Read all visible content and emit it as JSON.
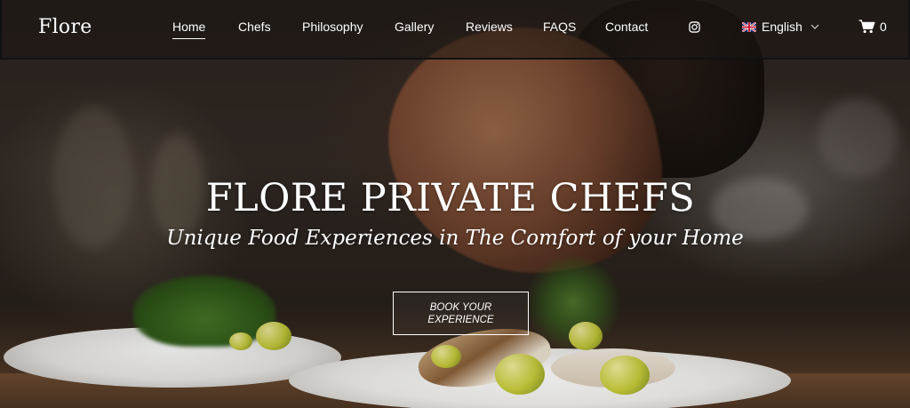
{
  "brand": {
    "logo": "Flore"
  },
  "nav": {
    "items": [
      {
        "label": "Home",
        "active": true
      },
      {
        "label": "Chefs"
      },
      {
        "label": "Philosophy"
      },
      {
        "label": "Gallery"
      },
      {
        "label": "Reviews"
      },
      {
        "label": "FAQS"
      },
      {
        "label": "Contact"
      }
    ],
    "social_icon": "instagram-icon",
    "language": {
      "label": "English",
      "flag": "uk-flag-icon"
    },
    "cart": {
      "icon": "cart-icon",
      "count": "0"
    }
  },
  "hero": {
    "title": "FLORE PRIVATE CHEFS",
    "subtitle": "Unique Food Experiences in The Comfort of your Home",
    "cta_label": "BOOK YOUR EXPERIENCE"
  },
  "colors": {
    "text": "#ffffff",
    "nav_background": "#1c1612"
  }
}
